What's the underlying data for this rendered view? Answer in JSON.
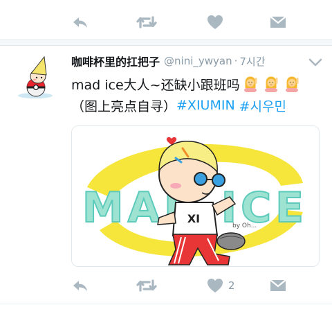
{
  "colors": {
    "icon_gray": "#aab8c2",
    "text_primary": "#14171a",
    "text_secondary": "#8899a6",
    "hashtag_blue": "#1da1f2",
    "separator": "#e6ecf0"
  },
  "top_actions": {
    "icons": [
      "reply-icon",
      "retweet-icon",
      "like-icon",
      "direct-message-icon"
    ]
  },
  "tweet": {
    "author": {
      "display_name": "咖啡杯里的扛把子",
      "handle": "@nini_ywyan",
      "separator": "·",
      "time": "7시간"
    },
    "text": {
      "line1": "mad ice大人~还缺小跟班吗",
      "line2_prefix": "（图上亮点自寻）",
      "hashtag1": "#XIUMIN",
      "hashtag2": "#시우민"
    },
    "emoji": [
      "person-raising-hand-emoji",
      "person-raising-hand-emoji",
      "person-raising-hand-emoji"
    ],
    "media": {
      "title_text": "MAD ICE",
      "shirt_text": "XI",
      "signature": "by Oh..."
    },
    "actions": {
      "like_count": "2",
      "icons": [
        "reply-icon",
        "retweet-icon",
        "like-icon",
        "direct-message-icon"
      ]
    }
  }
}
